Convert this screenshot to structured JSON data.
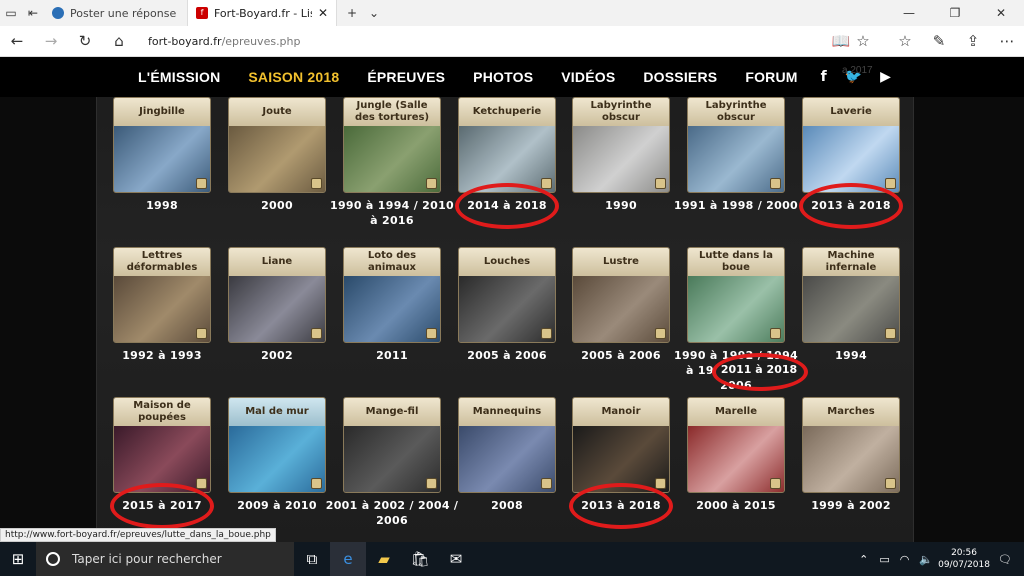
{
  "browser": {
    "tabs": [
      {
        "title": "Poster une réponse"
      },
      {
        "title": "Fort-Boyard.fr - Liste de"
      }
    ],
    "url_domain": "fort-boyard.fr",
    "url_path": "/epreuves.php",
    "status_url": "http://www.fort-boyard.fr/epreuves/lutte_dans_la_boue.php"
  },
  "menu": {
    "items": [
      "L'ÉMISSION",
      "SAISON 2018",
      "ÉPREUVES",
      "PHOTOS",
      "VIDÉOS",
      "DOSSIERS",
      "FORUM"
    ],
    "ghost": "a 2017"
  },
  "epreuves": [
    {
      "label": "Jingbille",
      "years": "1998"
    },
    {
      "label": "Joute",
      "years": "2000"
    },
    {
      "label": "Jungle (Salle des tortures)",
      "years": "1990 à 1994 / 2010 à 2016"
    },
    {
      "label": "Ketchuperie",
      "years": "2014 à 2018"
    },
    {
      "label": "Labyrinthe obscur",
      "years": "1990"
    },
    {
      "label": "Labyrinthe obscur",
      "years": "1991 à 1998 / 2000"
    },
    {
      "label": "Laverie",
      "years": "2013 à 2018"
    },
    {
      "label": "Lettres déformables",
      "years": "1992 à 1993"
    },
    {
      "label": "Liane",
      "years": "2002"
    },
    {
      "label": "Loto des animaux",
      "years": "2011"
    },
    {
      "label": "Louches",
      "years": "2005 à 2006"
    },
    {
      "label": "Lustre",
      "years": "2005 à 2006"
    },
    {
      "label": "Lutte dans la boue",
      "years": "1990 à 1992 / 1994 à 1999 / 2001 à 2006"
    },
    {
      "label": "Machine infernale",
      "years": "1994"
    },
    {
      "label": "Maison de poupées",
      "years": "2015 à 2017"
    },
    {
      "label": "Mal de mur",
      "years": "2009 à 2010"
    },
    {
      "label": "Mange-fil",
      "years": "2001 à 2002 / 2004 / 2006"
    },
    {
      "label": "Mannequins",
      "years": "2008"
    },
    {
      "label": "Manoir",
      "years": "2013 à 2018"
    },
    {
      "label": "Marelle",
      "years": "2000 à 2015"
    },
    {
      "label": "Marches",
      "years": "1999 à 2002"
    }
  ],
  "lutte_extra": "2011 à 2018",
  "taskbar": {
    "search_placeholder": "Taper ici pour rechercher",
    "time": "20:56",
    "date": "09/07/2018"
  }
}
